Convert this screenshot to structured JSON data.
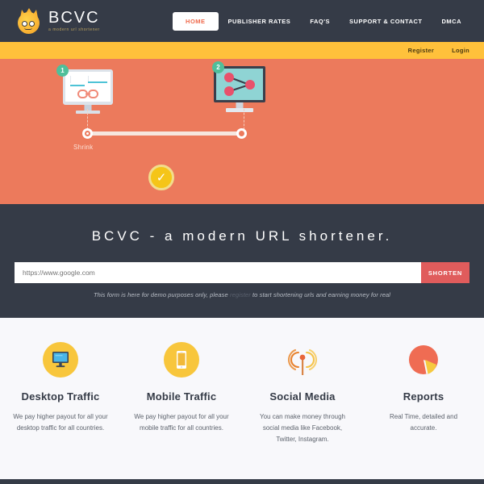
{
  "brand": {
    "name": "BCVC",
    "tagline": "a modern url shortener",
    "logo_icon": "bcvc-mascot-icon",
    "logo_color": "#f9b233"
  },
  "topnav": {
    "background": "#353b47",
    "items": [
      {
        "label": "HOME",
        "active": true
      },
      {
        "label": "PUBLISHER RATES",
        "active": false
      },
      {
        "label": "FAQ'S",
        "active": false
      },
      {
        "label": "SUPPORT & CONTACT",
        "active": false
      },
      {
        "label": "DMCA",
        "active": false
      }
    ]
  },
  "subbar": {
    "background": "#ffc13b",
    "links": [
      {
        "label": "Register"
      },
      {
        "label": "Login"
      }
    ]
  },
  "hero": {
    "background": "#ec7a5c",
    "step1_badge": "1",
    "step2_badge": "2",
    "check_icon": "checkmark-icon",
    "shrink_label": "Shrink",
    "monitor1_icon": "desktop-link-icon",
    "monitor2_icon": "desktop-share-icon"
  },
  "form_section": {
    "background": "#353b47",
    "headline": "BCVC - a modern URL shortener.",
    "input_placeholder": "https://www.google.com",
    "input_value": "",
    "submit_label": "SHORTEN",
    "submit_color": "#e05c5c",
    "disclaimer_before": "This form is here for demo purposes only, please ",
    "disclaimer_link": "register",
    "disclaimer_after": " to start shortening urls and earning money for real"
  },
  "features": {
    "background": "#f8f8fb",
    "items": [
      {
        "icon": "desktop-monitor-icon",
        "title": "Desktop Traffic",
        "desc": "We pay higher payout for all your desktop traffic for all countries."
      },
      {
        "icon": "mobile-phone-icon",
        "title": "Mobile Traffic",
        "desc": "We pay higher payout for all your mobile traffic for all countries."
      },
      {
        "icon": "broadcast-antenna-icon",
        "title": "Social Media",
        "desc": "You can make money through social media like Facebook, Twitter, Instagram."
      },
      {
        "icon": "pie-chart-icon",
        "title": "Reports",
        "desc": "Real Time, detailed and accurate."
      }
    ]
  }
}
